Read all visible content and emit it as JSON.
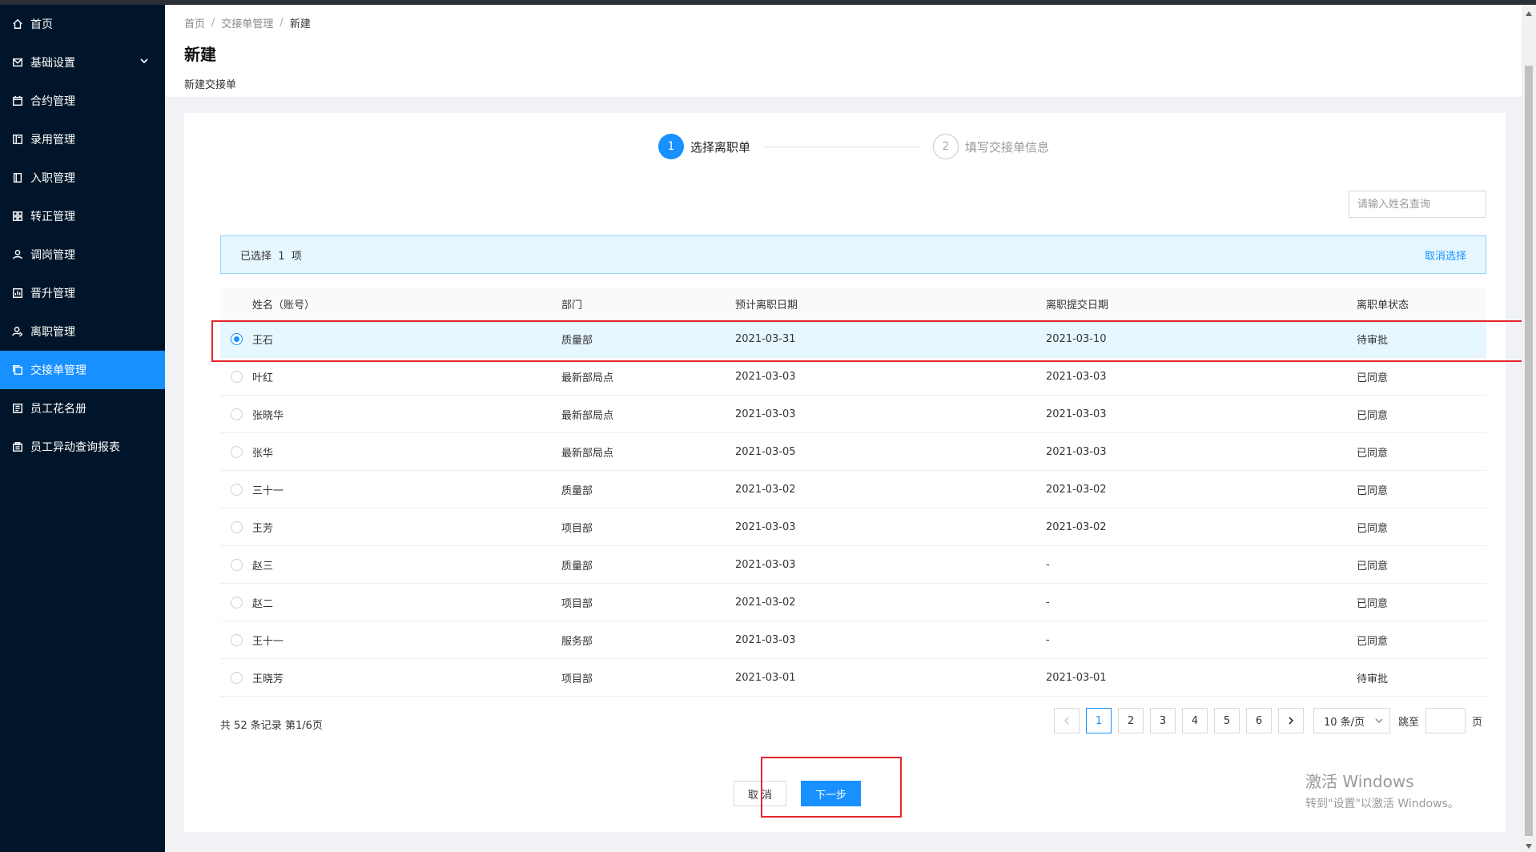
{
  "sidebar": {
    "items": [
      {
        "label": "首页",
        "icon": "home-icon"
      },
      {
        "label": "基础设置",
        "icon": "mail-icon",
        "has_arrow": true
      },
      {
        "label": "合约管理",
        "icon": "calendar-icon"
      },
      {
        "label": "录用管理",
        "icon": "book-icon"
      },
      {
        "label": "入职管理",
        "icon": "bookmark-icon"
      },
      {
        "label": "转正管理",
        "icon": "grid-icon"
      },
      {
        "label": "调岗管理",
        "icon": "user-icon"
      },
      {
        "label": "晋升管理",
        "icon": "chart-icon"
      },
      {
        "label": "离职管理",
        "icon": "user-leave-icon"
      },
      {
        "label": "交接单管理",
        "icon": "copy-icon",
        "active": true
      },
      {
        "label": "员工花名册",
        "icon": "list-icon"
      },
      {
        "label": "员工异动查询报表",
        "icon": "report-icon"
      }
    ]
  },
  "breadcrumb": {
    "home": "首页",
    "section": "交接单管理",
    "current": "新建",
    "sep": "/"
  },
  "page": {
    "title": "新建",
    "description": "新建交接单"
  },
  "steps": [
    {
      "number": "1",
      "title": "选择离职单",
      "status": "active"
    },
    {
      "number": "2",
      "title": "填写交接单信息",
      "status": "wait"
    }
  ],
  "search": {
    "placeholder": "请输入姓名查询"
  },
  "alert": {
    "text": "已选择  1  项",
    "clear": "取消选择"
  },
  "table": {
    "columns": [
      "姓名（账号）",
      "部门",
      "预计离职日期",
      "离职提交日期",
      "离职单状态"
    ],
    "rows": [
      {
        "name": "王石",
        "dept": "质量部",
        "expected": "2021-03-31",
        "submitted": "2021-03-10",
        "status": "待审批",
        "selected": true
      },
      {
        "name": "叶红",
        "dept": "最新部局点",
        "expected": "2021-03-03",
        "submitted": "2021-03-03",
        "status": "已同意",
        "selected": false
      },
      {
        "name": "张晓华",
        "dept": "最新部局点",
        "expected": "2021-03-03",
        "submitted": "2021-03-03",
        "status": "已同意",
        "selected": false
      },
      {
        "name": "张华",
        "dept": "最新部局点",
        "expected": "2021-03-05",
        "submitted": "2021-03-03",
        "status": "已同意",
        "selected": false
      },
      {
        "name": "三十一",
        "dept": "质量部",
        "expected": "2021-03-02",
        "submitted": "2021-03-02",
        "status": "已同意",
        "selected": false
      },
      {
        "name": "王芳",
        "dept": "项目部",
        "expected": "2021-03-03",
        "submitted": "2021-03-02",
        "status": "已同意",
        "selected": false
      },
      {
        "name": "赵三",
        "dept": "质量部",
        "expected": "2021-03-03",
        "submitted": "-",
        "status": "已同意",
        "selected": false
      },
      {
        "name": "赵二",
        "dept": "项目部",
        "expected": "2021-03-02",
        "submitted": "-",
        "status": "已同意",
        "selected": false
      },
      {
        "name": "王十一",
        "dept": "服务部",
        "expected": "2021-03-03",
        "submitted": "-",
        "status": "已同意",
        "selected": false
      },
      {
        "name": "王晓芳",
        "dept": "项目部",
        "expected": "2021-03-01",
        "submitted": "2021-03-01",
        "status": "待审批",
        "selected": false
      }
    ]
  },
  "pagination": {
    "total_text": "共 52 条记录 第1/6页",
    "pages": [
      "1",
      "2",
      "3",
      "4",
      "5",
      "6"
    ],
    "current": "1",
    "page_size": "10 条/页",
    "jump_label": "跳至",
    "page_suffix": "页"
  },
  "actions": {
    "cancel": "取 消",
    "next": "下一步"
  },
  "watermark": {
    "line1": "激活 Windows",
    "line2": "转到\"设置\"以激活 Windows。"
  },
  "colors": {
    "accent": "#1890ff",
    "sidebar_bg": "#001529",
    "highlight_red": "#e5262a"
  }
}
